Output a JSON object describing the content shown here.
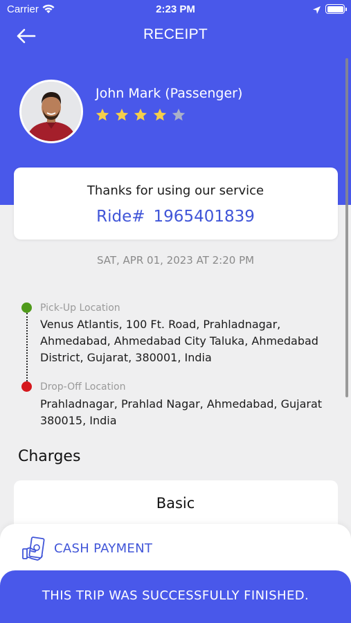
{
  "status_bar": {
    "carrier": "Carrier",
    "time": "2:23 PM"
  },
  "nav": {
    "title": "RECEIPT",
    "back_icon": "arrow-left-icon"
  },
  "passenger": {
    "name": "John Mark (Passenger)",
    "rating": 4,
    "rating_max": 5
  },
  "receipt_card": {
    "thanks": "Thanks for using our service",
    "ride_label": "Ride#",
    "ride_number": "1965401839"
  },
  "trip": {
    "date": "SAT, APR 01, 2023 AT 2:20 PM",
    "pickup": {
      "label": "Pick-Up Location",
      "address": "Venus Atlantis, 100 Ft. Road, Prahladnagar, Ahmedabad, Ahmedabad City Taluka, Ahmedabad District, Gujarat, 380001, India"
    },
    "dropoff": {
      "label": "Drop-Off Location",
      "address": "Prahladnagar, Prahlad Nagar, Ahmedabad, Gujarat 380015, India"
    }
  },
  "charges": {
    "title": "Charges",
    "section": "Basic"
  },
  "payment": {
    "method": "CASH PAYMENT",
    "icon": "cash-payment-icon"
  },
  "footer": {
    "status": "THIS TRIP WAS SUCCESSFULLY FINISHED."
  },
  "colors": {
    "primary": "#4958ea",
    "accent_text": "#4055d8",
    "pickup_dot": "#4f9a1a",
    "dropoff_dot": "#d5181d",
    "star_filled": "#f5cf4b",
    "star_empty": "#aab0c8",
    "background": "#efeff0"
  }
}
